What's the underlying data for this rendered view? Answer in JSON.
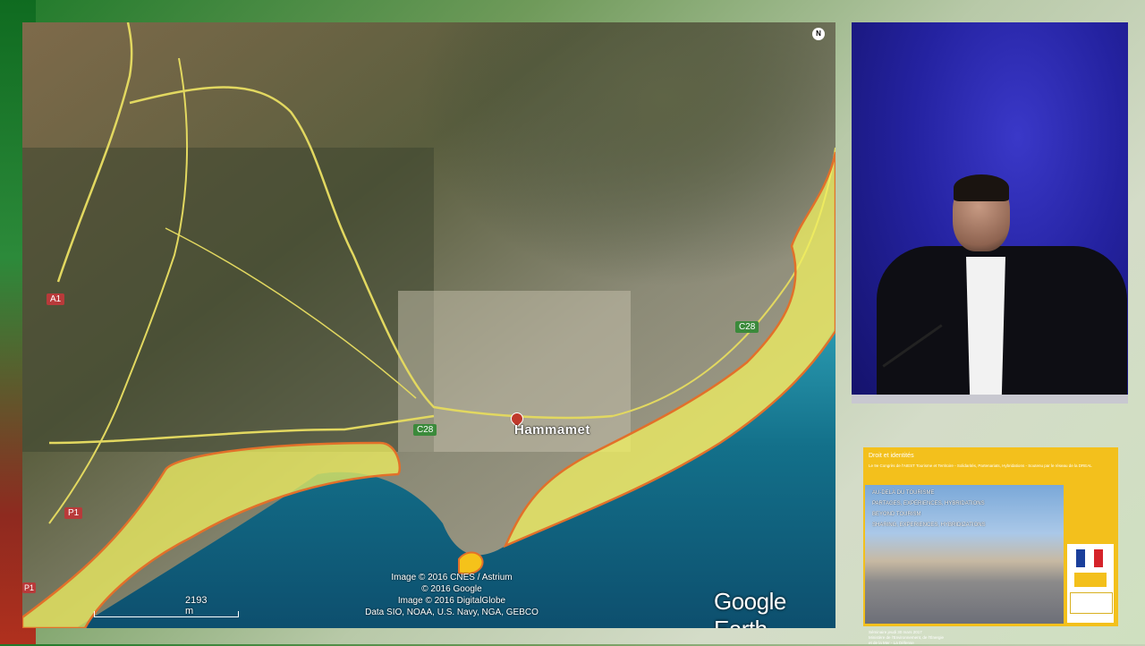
{
  "map": {
    "city_label": "Hammamet",
    "road_labels": {
      "a1": "A1",
      "p1": "P1",
      "p1_edge": "P1",
      "c28": "C28",
      "c28_east": "C28"
    },
    "attribution": [
      "Image © 2016 CNES / Astrium",
      "© 2016 Google",
      "Image © 2016 DigitalGlobe",
      "Data SIO, NOAA, U.S. Navy, NGA, GEBCO"
    ],
    "scale_label": "2193 m",
    "brand": "Google Earth",
    "north_label": "N",
    "colors": {
      "highlight_fill": "#f0f060",
      "highlight_stroke": "#e2702a",
      "sea_deep": "#0d4f6e",
      "sea_shallow": "#2a9ab0",
      "land": "#7c7a5a"
    }
  },
  "slide": {
    "top_line_1": "Droit et identités",
    "top_line_2": "Le 9e Congrès de l'AIEST Tourisme et Territoire - Solidarités, Partenariats, Hybridations - Soutenu par le réseau de la DREAL",
    "title_lines": [
      "AU-DELÀ DU TOURISME",
      "PARTAGES, EXPÉRIENCES, HYBRIDATIONS",
      "BEYOND TOURISM",
      "SHARING, EXPERIENCES, HYBRIDIZATIONS"
    ],
    "bottom_lines": [
      "Séminaire jeudi 30 mars 2017",
      "Ministère de l'Environnement, de l'Énergie",
      "et de la Mer - La Défense"
    ]
  }
}
